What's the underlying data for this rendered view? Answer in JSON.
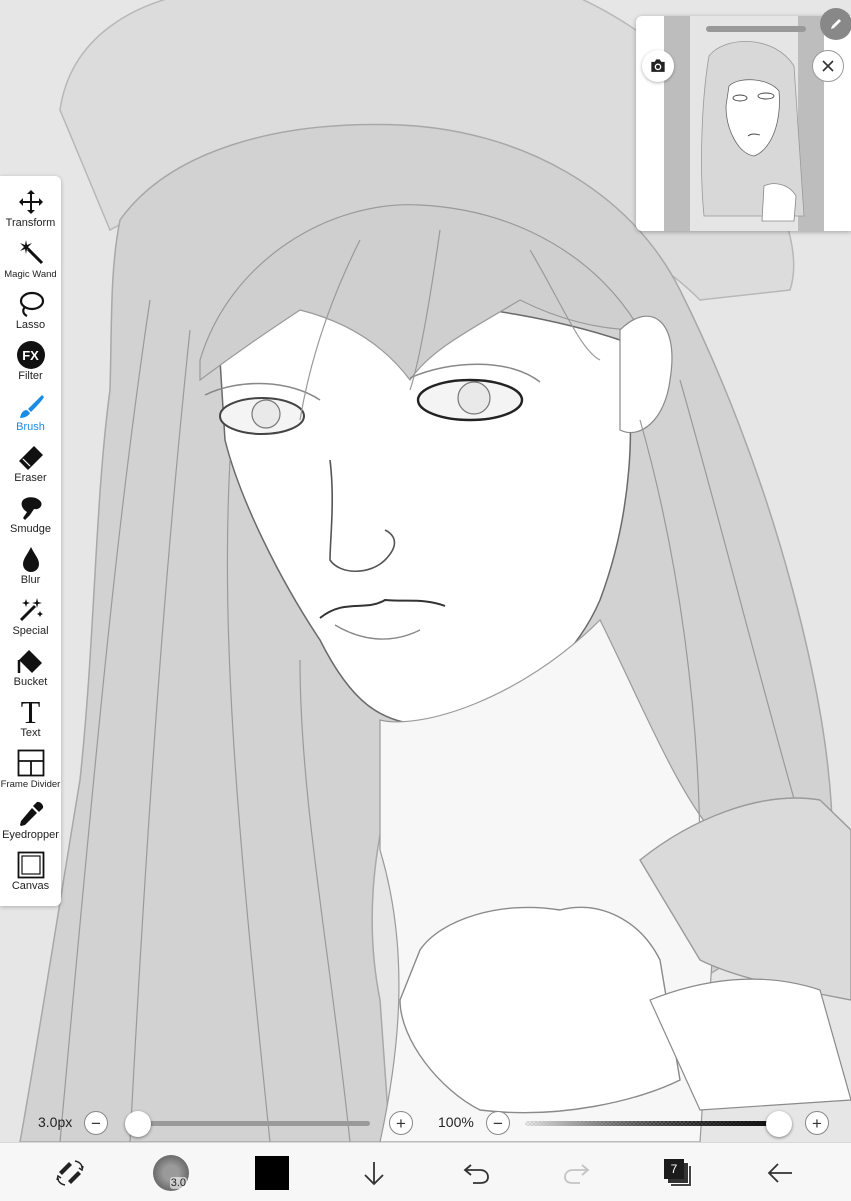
{
  "tools": [
    {
      "label": "Transform",
      "icon": "move-arrows-icon",
      "active": false
    },
    {
      "label": "Magic Wand",
      "icon": "magic-wand-icon",
      "active": false
    },
    {
      "label": "Lasso",
      "icon": "lasso-icon",
      "active": false
    },
    {
      "label": "Filter",
      "icon": "fx-filter-icon",
      "active": false
    },
    {
      "label": "Brush",
      "icon": "brush-icon",
      "active": true
    },
    {
      "label": "Eraser",
      "icon": "eraser-icon",
      "active": false
    },
    {
      "label": "Smudge",
      "icon": "smudge-finger-icon",
      "active": false
    },
    {
      "label": "Blur",
      "icon": "blur-drop-icon",
      "active": false
    },
    {
      "label": "Special",
      "icon": "special-sparkle-icon",
      "active": false
    },
    {
      "label": "Bucket",
      "icon": "bucket-icon",
      "active": false
    },
    {
      "label": "Text",
      "icon": "text-t-icon",
      "active": false
    },
    {
      "label": "Frame Divider",
      "icon": "frame-divider-icon",
      "active": false
    },
    {
      "label": "Eyedropper",
      "icon": "eyedropper-icon",
      "active": false
    },
    {
      "label": "Canvas",
      "icon": "canvas-icon",
      "active": false
    }
  ],
  "filter_icon_text": "FX",
  "text_icon_glyph": "T",
  "sliders": {
    "brush_size": {
      "label": "3.0px",
      "value_fraction": 0.0
    },
    "opacity": {
      "label": "100%",
      "value_fraction": 1.0
    },
    "minus": "−",
    "plus": "+"
  },
  "bottom_bar": {
    "brush_preview_value": "3.0",
    "current_color": "#000000",
    "layer_count": "7"
  },
  "colors": {
    "accent": "#1a8ce6",
    "panel": "#ffffff",
    "canvas_bg": "#e8e8e8"
  }
}
